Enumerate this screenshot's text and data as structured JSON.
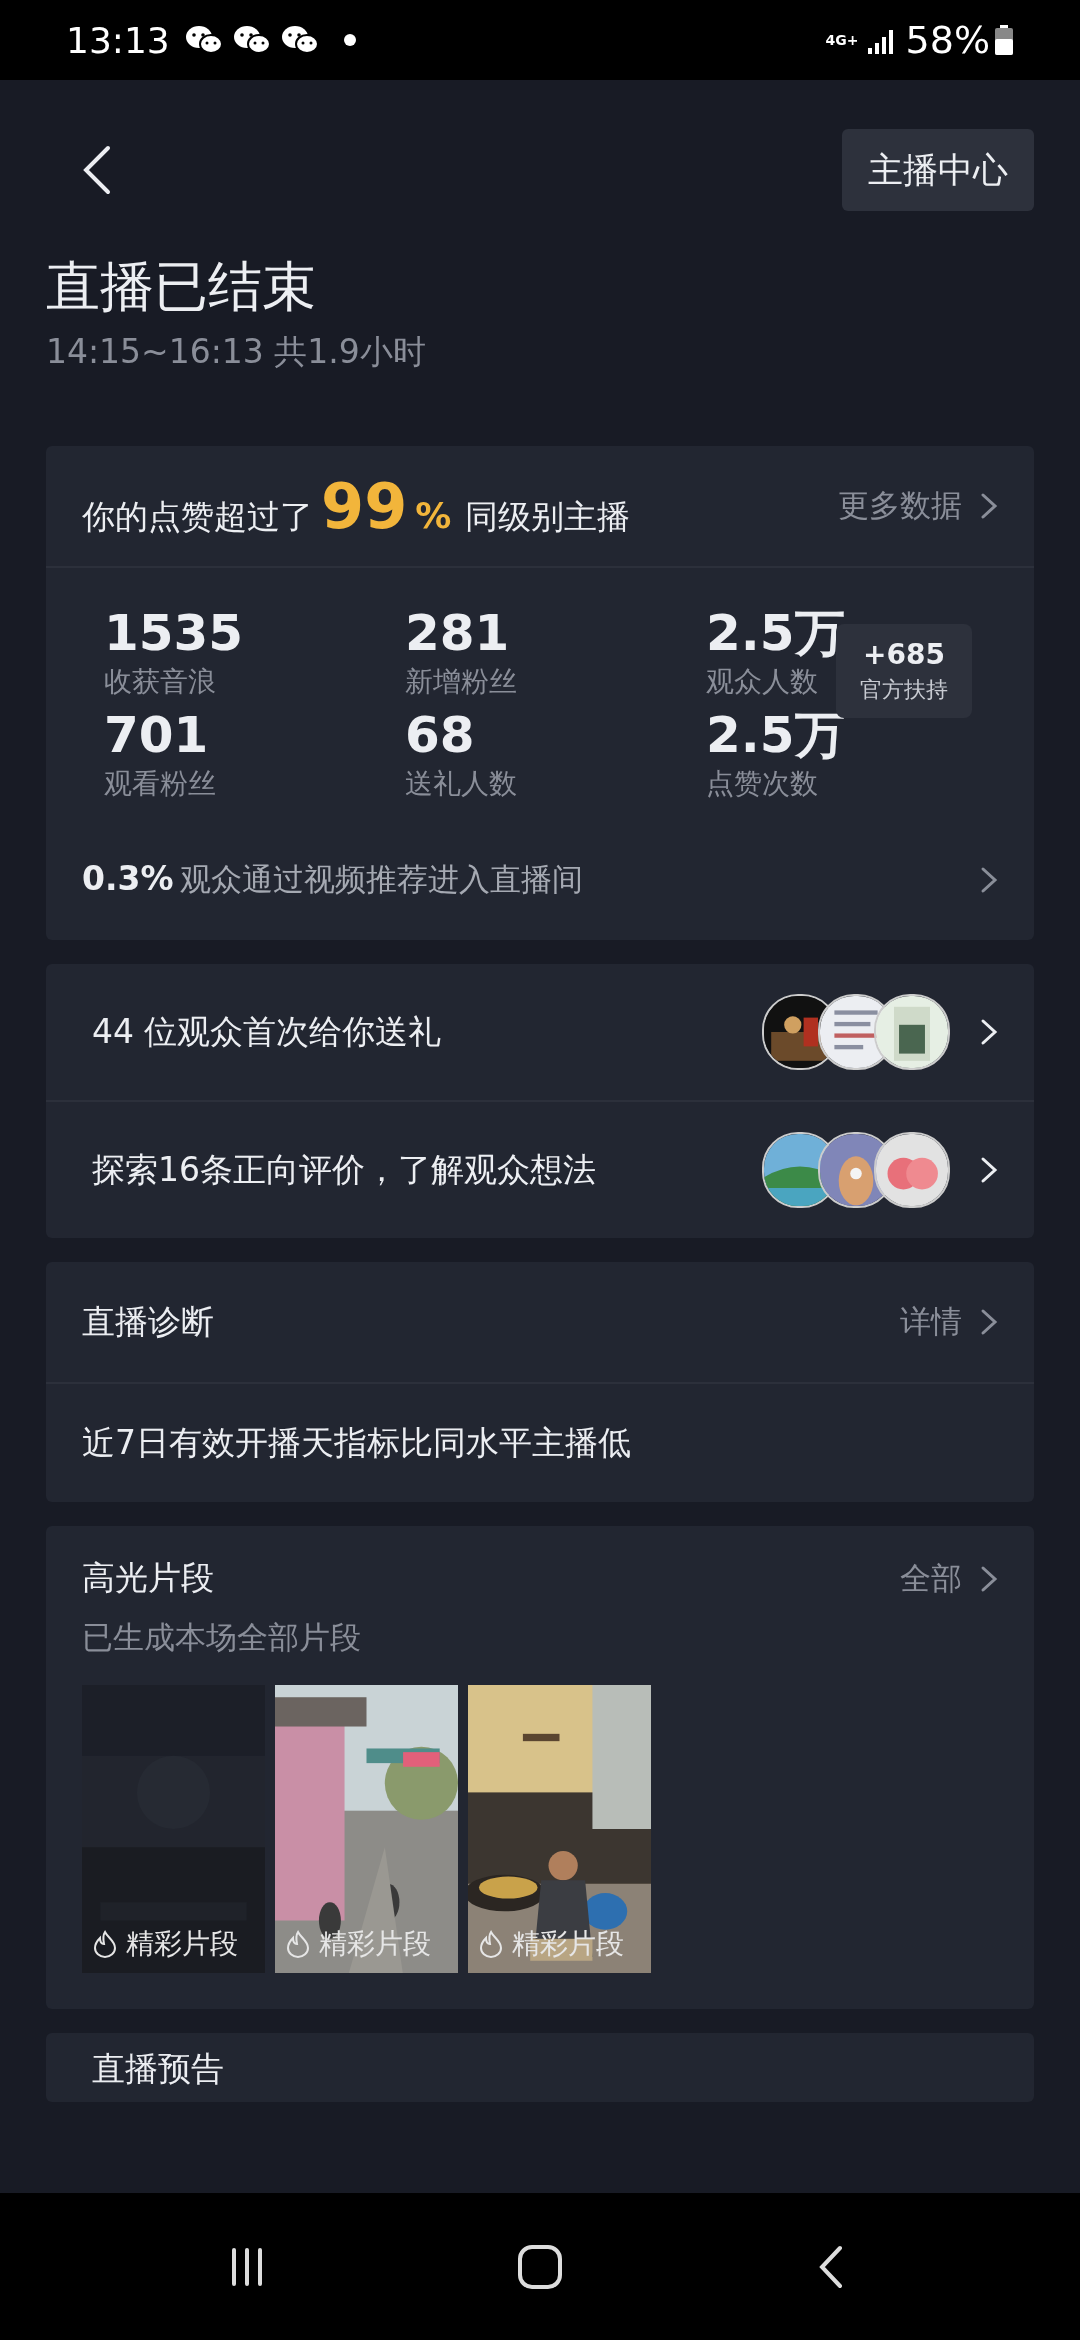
{
  "status_bar": {
    "time": "13:13",
    "network": "4G+",
    "battery": "58%"
  },
  "header": {
    "anchor_center_button": "主播中心"
  },
  "title": "直播已结束",
  "subtitle": "14:15~16:13 共1.9小时",
  "ranking": {
    "text_before": "你的点赞超过了",
    "percent_number": "99",
    "percent_sign": "%",
    "text_after": "同级别主播",
    "more_link": "更多数据"
  },
  "stats": [
    {
      "value": "1535",
      "label": "收获音浪"
    },
    {
      "value": "281",
      "label": "新增粉丝"
    },
    {
      "value": "2.5万",
      "label": "观众人数"
    },
    {
      "value": "701",
      "label": "观看粉丝"
    },
    {
      "value": "68",
      "label": "送礼人数"
    },
    {
      "value": "2.5万",
      "label": "点赞次数"
    }
  ],
  "boost_badge": {
    "value": "+685",
    "label": "官方扶持"
  },
  "recommend": {
    "percent": "0.3%",
    "text": "观众通过视频推荐进入直播间"
  },
  "audience_rows": [
    {
      "text": "44 位观众首次给你送礼"
    },
    {
      "text": "探索16条正向评价，了解观众想法"
    }
  ],
  "diagnosis": {
    "title": "直播诊断",
    "link": "详情",
    "message": "近7日有效开播天指标比同水平主播低"
  },
  "highlights": {
    "title": "高光片段",
    "link": "全部",
    "subtitle": "已生成本场全部片段",
    "clips": [
      {
        "label": "精彩片段",
        "kind": "picture"
      },
      {
        "label": "精彩片段",
        "kind": "picture"
      },
      {
        "label": "精彩片段",
        "kind": "picture"
      }
    ]
  },
  "next_card": {
    "title": "直播预告"
  }
}
